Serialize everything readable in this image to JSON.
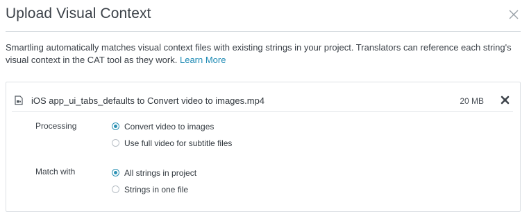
{
  "dialog": {
    "title": "Upload Visual Context",
    "description": "Smartling automatically matches visual context files with existing strings in your project. Translators can reference each string's visual context in the CAT tool as they work.",
    "learn_more": "Learn More",
    "close_icon": "close-icon"
  },
  "file": {
    "name": "iOS app_ui_tabs_defaults to Convert video to images.mp4",
    "size": "20 MB",
    "icon": "video-file-icon",
    "remove_icon": "remove-icon"
  },
  "processing": {
    "label": "Processing",
    "options": [
      {
        "label": "Convert video to images",
        "selected": true
      },
      {
        "label": "Use full video for subtitle files",
        "selected": false
      }
    ]
  },
  "match_with": {
    "label": "Match with",
    "options": [
      {
        "label": "All strings in project",
        "selected": true
      },
      {
        "label": "Strings in one file",
        "selected": false
      }
    ]
  },
  "colors": {
    "accent": "#2c92b4",
    "link": "#1e8ab4"
  }
}
